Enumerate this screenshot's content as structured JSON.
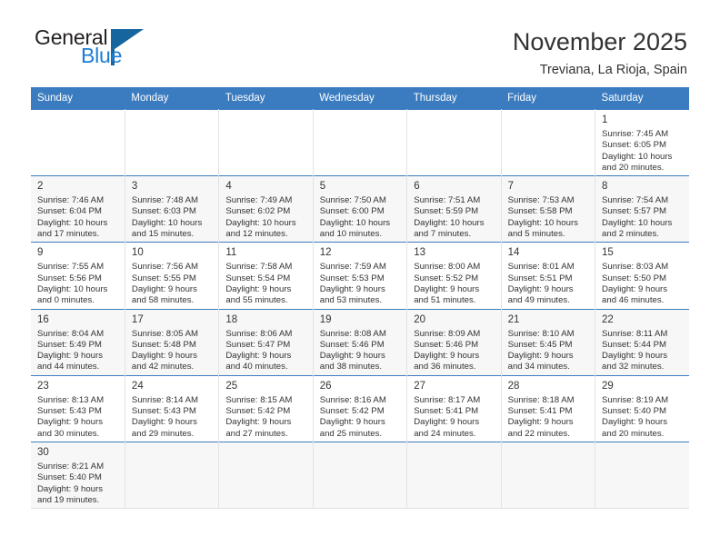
{
  "brand": {
    "name_part1": "General",
    "name_part2": "Blue",
    "triangle_icon": "blue-triangle-icon",
    "accent_color": "#1c7cd3",
    "dark_color": "#16659e"
  },
  "header": {
    "month_title": "November 2025",
    "location": "Treviana, La Rioja, Spain"
  },
  "calendar": {
    "header_bg": "#3b7cc0",
    "weekdays": [
      "Sunday",
      "Monday",
      "Tuesday",
      "Wednesday",
      "Thursday",
      "Friday",
      "Saturday"
    ],
    "weeks": [
      [
        {
          "empty": true
        },
        {
          "empty": true
        },
        {
          "empty": true
        },
        {
          "empty": true
        },
        {
          "empty": true
        },
        {
          "empty": true
        },
        {
          "day": "1",
          "sunrise": "Sunrise: 7:45 AM",
          "sunset": "Sunset: 6:05 PM",
          "daylight_line1": "Daylight: 10 hours",
          "daylight_line2": "and 20 minutes."
        }
      ],
      [
        {
          "day": "2",
          "sunrise": "Sunrise: 7:46 AM",
          "sunset": "Sunset: 6:04 PM",
          "daylight_line1": "Daylight: 10 hours",
          "daylight_line2": "and 17 minutes."
        },
        {
          "day": "3",
          "sunrise": "Sunrise: 7:48 AM",
          "sunset": "Sunset: 6:03 PM",
          "daylight_line1": "Daylight: 10 hours",
          "daylight_line2": "and 15 minutes."
        },
        {
          "day": "4",
          "sunrise": "Sunrise: 7:49 AM",
          "sunset": "Sunset: 6:02 PM",
          "daylight_line1": "Daylight: 10 hours",
          "daylight_line2": "and 12 minutes."
        },
        {
          "day": "5",
          "sunrise": "Sunrise: 7:50 AM",
          "sunset": "Sunset: 6:00 PM",
          "daylight_line1": "Daylight: 10 hours",
          "daylight_line2": "and 10 minutes."
        },
        {
          "day": "6",
          "sunrise": "Sunrise: 7:51 AM",
          "sunset": "Sunset: 5:59 PM",
          "daylight_line1": "Daylight: 10 hours",
          "daylight_line2": "and 7 minutes."
        },
        {
          "day": "7",
          "sunrise": "Sunrise: 7:53 AM",
          "sunset": "Sunset: 5:58 PM",
          "daylight_line1": "Daylight: 10 hours",
          "daylight_line2": "and 5 minutes."
        },
        {
          "day": "8",
          "sunrise": "Sunrise: 7:54 AM",
          "sunset": "Sunset: 5:57 PM",
          "daylight_line1": "Daylight: 10 hours",
          "daylight_line2": "and 2 minutes."
        }
      ],
      [
        {
          "day": "9",
          "sunrise": "Sunrise: 7:55 AM",
          "sunset": "Sunset: 5:56 PM",
          "daylight_line1": "Daylight: 10 hours",
          "daylight_line2": "and 0 minutes."
        },
        {
          "day": "10",
          "sunrise": "Sunrise: 7:56 AM",
          "sunset": "Sunset: 5:55 PM",
          "daylight_line1": "Daylight: 9 hours",
          "daylight_line2": "and 58 minutes."
        },
        {
          "day": "11",
          "sunrise": "Sunrise: 7:58 AM",
          "sunset": "Sunset: 5:54 PM",
          "daylight_line1": "Daylight: 9 hours",
          "daylight_line2": "and 55 minutes."
        },
        {
          "day": "12",
          "sunrise": "Sunrise: 7:59 AM",
          "sunset": "Sunset: 5:53 PM",
          "daylight_line1": "Daylight: 9 hours",
          "daylight_line2": "and 53 minutes."
        },
        {
          "day": "13",
          "sunrise": "Sunrise: 8:00 AM",
          "sunset": "Sunset: 5:52 PM",
          "daylight_line1": "Daylight: 9 hours",
          "daylight_line2": "and 51 minutes."
        },
        {
          "day": "14",
          "sunrise": "Sunrise: 8:01 AM",
          "sunset": "Sunset: 5:51 PM",
          "daylight_line1": "Daylight: 9 hours",
          "daylight_line2": "and 49 minutes."
        },
        {
          "day": "15",
          "sunrise": "Sunrise: 8:03 AM",
          "sunset": "Sunset: 5:50 PM",
          "daylight_line1": "Daylight: 9 hours",
          "daylight_line2": "and 46 minutes."
        }
      ],
      [
        {
          "day": "16",
          "sunrise": "Sunrise: 8:04 AM",
          "sunset": "Sunset: 5:49 PM",
          "daylight_line1": "Daylight: 9 hours",
          "daylight_line2": "and 44 minutes."
        },
        {
          "day": "17",
          "sunrise": "Sunrise: 8:05 AM",
          "sunset": "Sunset: 5:48 PM",
          "daylight_line1": "Daylight: 9 hours",
          "daylight_line2": "and 42 minutes."
        },
        {
          "day": "18",
          "sunrise": "Sunrise: 8:06 AM",
          "sunset": "Sunset: 5:47 PM",
          "daylight_line1": "Daylight: 9 hours",
          "daylight_line2": "and 40 minutes."
        },
        {
          "day": "19",
          "sunrise": "Sunrise: 8:08 AM",
          "sunset": "Sunset: 5:46 PM",
          "daylight_line1": "Daylight: 9 hours",
          "daylight_line2": "and 38 minutes."
        },
        {
          "day": "20",
          "sunrise": "Sunrise: 8:09 AM",
          "sunset": "Sunset: 5:46 PM",
          "daylight_line1": "Daylight: 9 hours",
          "daylight_line2": "and 36 minutes."
        },
        {
          "day": "21",
          "sunrise": "Sunrise: 8:10 AM",
          "sunset": "Sunset: 5:45 PM",
          "daylight_line1": "Daylight: 9 hours",
          "daylight_line2": "and 34 minutes."
        },
        {
          "day": "22",
          "sunrise": "Sunrise: 8:11 AM",
          "sunset": "Sunset: 5:44 PM",
          "daylight_line1": "Daylight: 9 hours",
          "daylight_line2": "and 32 minutes."
        }
      ],
      [
        {
          "day": "23",
          "sunrise": "Sunrise: 8:13 AM",
          "sunset": "Sunset: 5:43 PM",
          "daylight_line1": "Daylight: 9 hours",
          "daylight_line2": "and 30 minutes."
        },
        {
          "day": "24",
          "sunrise": "Sunrise: 8:14 AM",
          "sunset": "Sunset: 5:43 PM",
          "daylight_line1": "Daylight: 9 hours",
          "daylight_line2": "and 29 minutes."
        },
        {
          "day": "25",
          "sunrise": "Sunrise: 8:15 AM",
          "sunset": "Sunset: 5:42 PM",
          "daylight_line1": "Daylight: 9 hours",
          "daylight_line2": "and 27 minutes."
        },
        {
          "day": "26",
          "sunrise": "Sunrise: 8:16 AM",
          "sunset": "Sunset: 5:42 PM",
          "daylight_line1": "Daylight: 9 hours",
          "daylight_line2": "and 25 minutes."
        },
        {
          "day": "27",
          "sunrise": "Sunrise: 8:17 AM",
          "sunset": "Sunset: 5:41 PM",
          "daylight_line1": "Daylight: 9 hours",
          "daylight_line2": "and 24 minutes."
        },
        {
          "day": "28",
          "sunrise": "Sunrise: 8:18 AM",
          "sunset": "Sunset: 5:41 PM",
          "daylight_line1": "Daylight: 9 hours",
          "daylight_line2": "and 22 minutes."
        },
        {
          "day": "29",
          "sunrise": "Sunrise: 8:19 AM",
          "sunset": "Sunset: 5:40 PM",
          "daylight_line1": "Daylight: 9 hours",
          "daylight_line2": "and 20 minutes."
        }
      ],
      [
        {
          "day": "30",
          "sunrise": "Sunrise: 8:21 AM",
          "sunset": "Sunset: 5:40 PM",
          "daylight_line1": "Daylight: 9 hours",
          "daylight_line2": "and 19 minutes."
        },
        {
          "empty": true
        },
        {
          "empty": true
        },
        {
          "empty": true
        },
        {
          "empty": true
        },
        {
          "empty": true
        },
        {
          "empty": true
        }
      ]
    ]
  }
}
